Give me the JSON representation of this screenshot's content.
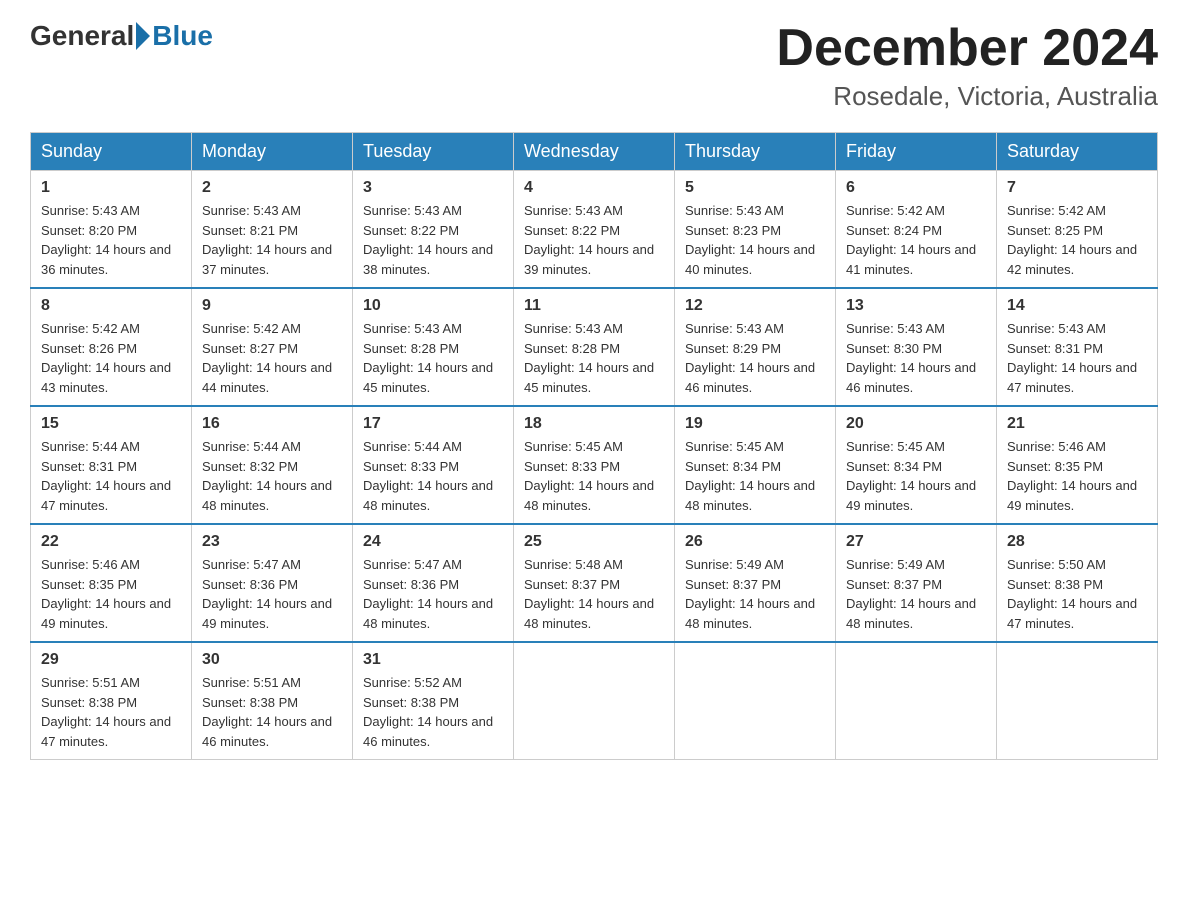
{
  "header": {
    "logo_general": "General",
    "logo_blue": "Blue",
    "title": "December 2024",
    "subtitle": "Rosedale, Victoria, Australia"
  },
  "days_of_week": [
    "Sunday",
    "Monday",
    "Tuesday",
    "Wednesday",
    "Thursday",
    "Friday",
    "Saturday"
  ],
  "weeks": [
    [
      {
        "day": "1",
        "sunrise": "5:43 AM",
        "sunset": "8:20 PM",
        "daylight": "14 hours and 36 minutes."
      },
      {
        "day": "2",
        "sunrise": "5:43 AM",
        "sunset": "8:21 PM",
        "daylight": "14 hours and 37 minutes."
      },
      {
        "day": "3",
        "sunrise": "5:43 AM",
        "sunset": "8:22 PM",
        "daylight": "14 hours and 38 minutes."
      },
      {
        "day": "4",
        "sunrise": "5:43 AM",
        "sunset": "8:22 PM",
        "daylight": "14 hours and 39 minutes."
      },
      {
        "day": "5",
        "sunrise": "5:43 AM",
        "sunset": "8:23 PM",
        "daylight": "14 hours and 40 minutes."
      },
      {
        "day": "6",
        "sunrise": "5:42 AM",
        "sunset": "8:24 PM",
        "daylight": "14 hours and 41 minutes."
      },
      {
        "day": "7",
        "sunrise": "5:42 AM",
        "sunset": "8:25 PM",
        "daylight": "14 hours and 42 minutes."
      }
    ],
    [
      {
        "day": "8",
        "sunrise": "5:42 AM",
        "sunset": "8:26 PM",
        "daylight": "14 hours and 43 minutes."
      },
      {
        "day": "9",
        "sunrise": "5:42 AM",
        "sunset": "8:27 PM",
        "daylight": "14 hours and 44 minutes."
      },
      {
        "day": "10",
        "sunrise": "5:43 AM",
        "sunset": "8:28 PM",
        "daylight": "14 hours and 45 minutes."
      },
      {
        "day": "11",
        "sunrise": "5:43 AM",
        "sunset": "8:28 PM",
        "daylight": "14 hours and 45 minutes."
      },
      {
        "day": "12",
        "sunrise": "5:43 AM",
        "sunset": "8:29 PM",
        "daylight": "14 hours and 46 minutes."
      },
      {
        "day": "13",
        "sunrise": "5:43 AM",
        "sunset": "8:30 PM",
        "daylight": "14 hours and 46 minutes."
      },
      {
        "day": "14",
        "sunrise": "5:43 AM",
        "sunset": "8:31 PM",
        "daylight": "14 hours and 47 minutes."
      }
    ],
    [
      {
        "day": "15",
        "sunrise": "5:44 AM",
        "sunset": "8:31 PM",
        "daylight": "14 hours and 47 minutes."
      },
      {
        "day": "16",
        "sunrise": "5:44 AM",
        "sunset": "8:32 PM",
        "daylight": "14 hours and 48 minutes."
      },
      {
        "day": "17",
        "sunrise": "5:44 AM",
        "sunset": "8:33 PM",
        "daylight": "14 hours and 48 minutes."
      },
      {
        "day": "18",
        "sunrise": "5:45 AM",
        "sunset": "8:33 PM",
        "daylight": "14 hours and 48 minutes."
      },
      {
        "day": "19",
        "sunrise": "5:45 AM",
        "sunset": "8:34 PM",
        "daylight": "14 hours and 48 minutes."
      },
      {
        "day": "20",
        "sunrise": "5:45 AM",
        "sunset": "8:34 PM",
        "daylight": "14 hours and 49 minutes."
      },
      {
        "day": "21",
        "sunrise": "5:46 AM",
        "sunset": "8:35 PM",
        "daylight": "14 hours and 49 minutes."
      }
    ],
    [
      {
        "day": "22",
        "sunrise": "5:46 AM",
        "sunset": "8:35 PM",
        "daylight": "14 hours and 49 minutes."
      },
      {
        "day": "23",
        "sunrise": "5:47 AM",
        "sunset": "8:36 PM",
        "daylight": "14 hours and 49 minutes."
      },
      {
        "day": "24",
        "sunrise": "5:47 AM",
        "sunset": "8:36 PM",
        "daylight": "14 hours and 48 minutes."
      },
      {
        "day": "25",
        "sunrise": "5:48 AM",
        "sunset": "8:37 PM",
        "daylight": "14 hours and 48 minutes."
      },
      {
        "day": "26",
        "sunrise": "5:49 AM",
        "sunset": "8:37 PM",
        "daylight": "14 hours and 48 minutes."
      },
      {
        "day": "27",
        "sunrise": "5:49 AM",
        "sunset": "8:37 PM",
        "daylight": "14 hours and 48 minutes."
      },
      {
        "day": "28",
        "sunrise": "5:50 AM",
        "sunset": "8:38 PM",
        "daylight": "14 hours and 47 minutes."
      }
    ],
    [
      {
        "day": "29",
        "sunrise": "5:51 AM",
        "sunset": "8:38 PM",
        "daylight": "14 hours and 47 minutes."
      },
      {
        "day": "30",
        "sunrise": "5:51 AM",
        "sunset": "8:38 PM",
        "daylight": "14 hours and 46 minutes."
      },
      {
        "day": "31",
        "sunrise": "5:52 AM",
        "sunset": "8:38 PM",
        "daylight": "14 hours and 46 minutes."
      },
      null,
      null,
      null,
      null
    ]
  ],
  "labels": {
    "sunrise": "Sunrise:",
    "sunset": "Sunset:",
    "daylight": "Daylight:"
  }
}
